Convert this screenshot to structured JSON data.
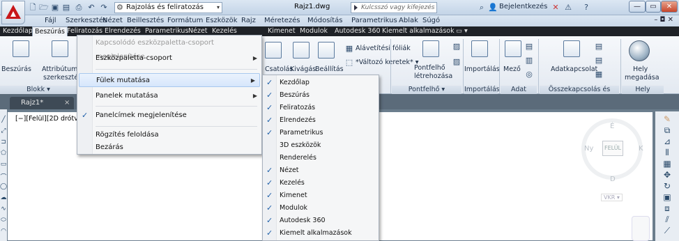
{
  "titlebar": {
    "workspace": "Rajzolás és feliratozás",
    "doc_title": "Rajz1.dwg",
    "search_placeholder": "Kulcsszó vagy kifejezés",
    "login": "Bejelentkezés"
  },
  "menubar": [
    "Fájl",
    "Szerkesztés",
    "Nézet",
    "Beillesztés",
    "Formátum",
    "Eszközök",
    "Rajz",
    "Méretezés",
    "Módosítás",
    "Parametrikus",
    "Ablak",
    "Súgó"
  ],
  "ribbon_tabs": [
    "Kezdőlap",
    "Beszúrás",
    "Feliratozás",
    "Elrendezés",
    "Parametrikus",
    "Nézet",
    "Kezelés",
    "Kimenet",
    "Modulok",
    "Autodesk 360",
    "Kiemelt alkalmazások"
  ],
  "ribbon": {
    "beszuras": "Beszúrás",
    "attrib1": "Attribútumo",
    "attrib2": "szerkesztés",
    "blokk": "Blokk ▾",
    "csatolas": "Csatolás",
    "kivagas": "Kivágás",
    "beallitas": "Beállítás",
    "alavetitesi": "Alávetítési fóliák",
    "valtozo": "*Változó keretek* ▾",
    "pontfelho1": "Pontfelhő",
    "pontfelho2": "létrehozása",
    "importalas": "Importálás",
    "mezo": "Mező",
    "adatkapcsolat": "Adatkapcsolat",
    "hely1": "Hely",
    "hely2": "megadása",
    "panel_pontfelho": "Pontfelhő ▾",
    "panel_importalas": "Importálás",
    "panel_adat": "Adat",
    "panel_osszekapcsolas": "Összekapcsolás és kiemelés",
    "panel_hely": "Hely"
  },
  "drawing_tab": "Rajz1*",
  "viewport_label": "[−][Felül][2D drótv",
  "viewcube": {
    "top": "FELÜL",
    "north": "É",
    "south": "D",
    "west": "Ny",
    "east": "K",
    "wcs": "VKR ▾"
  },
  "context_menu": [
    {
      "label": "Kapcsolódó eszközpaletta-csoport megjelenítése",
      "disabled": true
    },
    {
      "label": "Eszközpaletta-csoport",
      "submenu": true
    },
    {
      "label": "Fülek mutatása",
      "submenu": true,
      "highlighted": true
    },
    {
      "label": "Panelek mutatása",
      "submenu": true
    },
    {
      "label": "Panelcímek megjelenítése",
      "checked": true
    },
    {
      "label": "Rögzítés feloldása"
    },
    {
      "label": "Bezárás"
    }
  ],
  "submenu": [
    {
      "label": "Kezdőlap",
      "checked": true
    },
    {
      "label": "Beszúrás",
      "checked": true
    },
    {
      "label": "Feliratozás",
      "checked": true
    },
    {
      "label": "Elrendezés",
      "checked": true
    },
    {
      "label": "Parametrikus",
      "checked": true
    },
    {
      "label": "3D eszközök",
      "checked": false
    },
    {
      "label": "Renderelés",
      "checked": false
    },
    {
      "label": "Nézet",
      "checked": true
    },
    {
      "label": "Kezelés",
      "checked": true
    },
    {
      "label": "Kimenet",
      "checked": true
    },
    {
      "label": "Modulok",
      "checked": true
    },
    {
      "label": "Autodesk 360",
      "checked": true
    },
    {
      "label": "Kiemelt alkalmazások",
      "checked": true
    }
  ]
}
